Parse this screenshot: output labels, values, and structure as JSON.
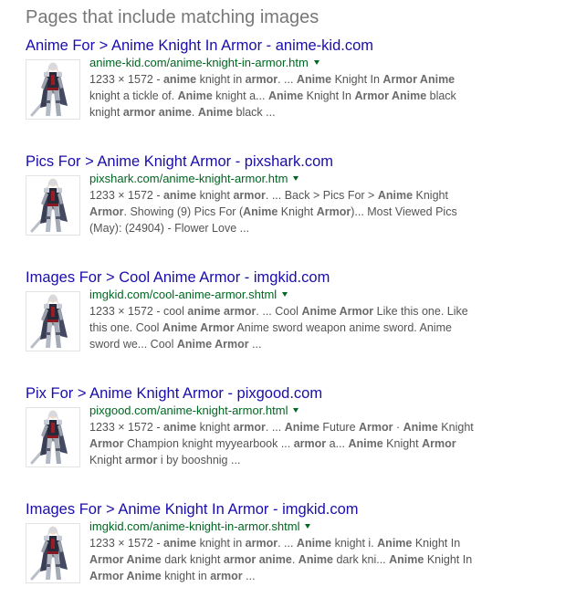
{
  "heading": "Pages that include matching images",
  "results": [
    {
      "title": "Anime For > Anime Knight In Armor - anime-kid.com",
      "url": "anime-kid.com/anime-knight-in-armor.htm",
      "snippet": [
        [
          {
            "t": "1233 × 1572 - ",
            "b": false
          },
          {
            "t": "anime",
            "b": true
          },
          {
            "t": " knight in ",
            "b": false
          },
          {
            "t": "armor",
            "b": true
          },
          {
            "t": ". ... ",
            "b": false
          },
          {
            "t": "Anime",
            "b": true
          },
          {
            "t": " Knight In ",
            "b": false
          },
          {
            "t": "Armor Anime",
            "b": true
          }
        ],
        [
          {
            "t": "knight a tickle of. ",
            "b": false
          },
          {
            "t": "Anime",
            "b": true
          },
          {
            "t": " knight a... ",
            "b": false
          },
          {
            "t": "Anime",
            "b": true
          },
          {
            "t": " Knight In ",
            "b": false
          },
          {
            "t": "Armor Anime",
            "b": true
          },
          {
            "t": " black",
            "b": false
          }
        ],
        [
          {
            "t": "knight ",
            "b": false
          },
          {
            "t": "armor anime",
            "b": true
          },
          {
            "t": ". ",
            "b": false
          },
          {
            "t": "Anime",
            "b": true
          },
          {
            "t": " black ...",
            "b": false
          }
        ]
      ]
    },
    {
      "title": "Pics For > Anime Knight Armor - pixshark.com",
      "url": "pixshark.com/anime-knight-armor.htm",
      "snippet": [
        [
          {
            "t": "1233 × 1572 - ",
            "b": false
          },
          {
            "t": "anime",
            "b": true
          },
          {
            "t": " knight ",
            "b": false
          },
          {
            "t": "armor",
            "b": true
          },
          {
            "t": ". ... Back > Pics For > ",
            "b": false
          },
          {
            "t": "Anime",
            "b": true
          },
          {
            "t": " Knight",
            "b": false
          }
        ],
        [
          {
            "t": "Armor",
            "b": true
          },
          {
            "t": ". Showing (9) Pics For (",
            "b": false
          },
          {
            "t": "Anime",
            "b": true
          },
          {
            "t": " Knight ",
            "b": false
          },
          {
            "t": "Armor",
            "b": true
          },
          {
            "t": ")... Most Viewed Pics",
            "b": false
          }
        ],
        [
          {
            "t": "(May): (24904) - Flower Love ...",
            "b": false
          }
        ]
      ]
    },
    {
      "title": "Images For > Cool Anime Armor - imgkid.com",
      "url": "imgkid.com/cool-anime-armor.shtml",
      "snippet": [
        [
          {
            "t": "1233 × 1572 - cool ",
            "b": false
          },
          {
            "t": "anime armor",
            "b": true
          },
          {
            "t": ". ... Cool ",
            "b": false
          },
          {
            "t": "Anime Armor",
            "b": true
          },
          {
            "t": " Like this one. Like",
            "b": false
          }
        ],
        [
          {
            "t": "this one. Cool ",
            "b": false
          },
          {
            "t": "Anime Armor",
            "b": true
          },
          {
            "t": " Anime sword weapon anime sword. Anime",
            "b": false
          }
        ],
        [
          {
            "t": "sword we... Cool ",
            "b": false
          },
          {
            "t": "Anime Armor",
            "b": true
          },
          {
            "t": " ...",
            "b": false
          }
        ]
      ]
    },
    {
      "title": "Pix For > Anime Knight Armor - pixgood.com",
      "url": "pixgood.com/anime-knight-armor.html",
      "snippet": [
        [
          {
            "t": "1233 × 1572 - ",
            "b": false
          },
          {
            "t": "anime",
            "b": true
          },
          {
            "t": " knight ",
            "b": false
          },
          {
            "t": "armor",
            "b": true
          },
          {
            "t": ". ... ",
            "b": false
          },
          {
            "t": "Anime",
            "b": true
          },
          {
            "t": " Future ",
            "b": false
          },
          {
            "t": "Armor",
            "b": true
          },
          {
            "t": " · ",
            "b": false
          },
          {
            "t": "Anime",
            "b": true
          },
          {
            "t": " Knight",
            "b": false
          }
        ],
        [
          {
            "t": "Armor",
            "b": true
          },
          {
            "t": " Champion knight myyearbook ... ",
            "b": false
          },
          {
            "t": "armor",
            "b": true
          },
          {
            "t": " a... ",
            "b": false
          },
          {
            "t": "Anime",
            "b": true
          },
          {
            "t": " Knight ",
            "b": false
          },
          {
            "t": "Armor",
            "b": true
          }
        ],
        [
          {
            "t": "Knight ",
            "b": false
          },
          {
            "t": "armor",
            "b": true
          },
          {
            "t": " i by booshnig ...",
            "b": false
          }
        ]
      ]
    },
    {
      "title": "Images For > Anime Knight In Armor - imgkid.com",
      "url": "imgkid.com/anime-knight-in-armor.shtml",
      "snippet": [
        [
          {
            "t": "1233 × 1572 - ",
            "b": false
          },
          {
            "t": "anime",
            "b": true
          },
          {
            "t": " knight in ",
            "b": false
          },
          {
            "t": "armor",
            "b": true
          },
          {
            "t": ". ... ",
            "b": false
          },
          {
            "t": "Anime",
            "b": true
          },
          {
            "t": " knight i. ",
            "b": false
          },
          {
            "t": "Anime",
            "b": true
          },
          {
            "t": " Knight In",
            "b": false
          }
        ],
        [
          {
            "t": "Armor Anime",
            "b": true
          },
          {
            "t": " dark knight ",
            "b": false
          },
          {
            "t": "armor anime",
            "b": true
          },
          {
            "t": ". ",
            "b": false
          },
          {
            "t": "Anime",
            "b": true
          },
          {
            "t": " dark kni... ",
            "b": false
          },
          {
            "t": "Anime",
            "b": true
          },
          {
            "t": " Knight In",
            "b": false
          }
        ],
        [
          {
            "t": "Armor Anime",
            "b": true
          },
          {
            "t": " knight in ",
            "b": false
          },
          {
            "t": "armor",
            "b": true
          },
          {
            "t": " ...",
            "b": false
          }
        ]
      ]
    }
  ]
}
